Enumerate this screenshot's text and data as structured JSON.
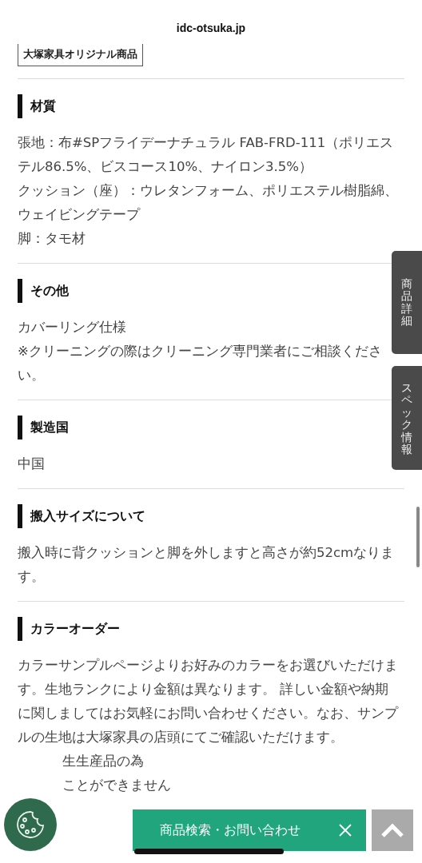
{
  "address_bar": {
    "domain": "idc-otsuka.jp"
  },
  "tag": {
    "label": "大塚家具オリジナル商品"
  },
  "sections": [
    {
      "heading": "材質",
      "paragraphs": [
        "張地：布#SPフライデーナチュラル FAB-FRD-111（ポリエステル86.5%、ビスコース10%、ナイロン3.5%）",
        "クッション（座）：ウレタンフォーム、ポリエステル樹脂綿、ウェイビングテープ",
        "脚：タモ材"
      ]
    },
    {
      "heading": "その他",
      "paragraphs": [
        "カバーリング仕様",
        "※クリーニングの際はクリーニング専門業者にご相談ください。"
      ]
    },
    {
      "heading": "製造国",
      "paragraphs": [
        "中国"
      ]
    },
    {
      "heading": "搬入サイズについて",
      "paragraphs": [
        "搬入時に背クッションと脚を外しますと高さが約52cmなります。"
      ]
    },
    {
      "heading": "カラーオーダー",
      "paragraphs": [
        "カラーサンプルページよりお好みのカラーをお選びいただけます。生地ランクにより金額は異なります。 詳しい金額や納期に関しましてはお気軽にお問い合わせください。なお、サンプルの生地は大塚家具の店頭にてご確認いただけます。"
      ],
      "partial_lines": [
        "生生産品の為",
        "ことができません"
      ]
    }
  ],
  "side_tabs": [
    {
      "label": "商品詳細"
    },
    {
      "label": "スペック情報"
    }
  ],
  "search_bar": {
    "label": "商品検索・お問い合わせ"
  }
}
